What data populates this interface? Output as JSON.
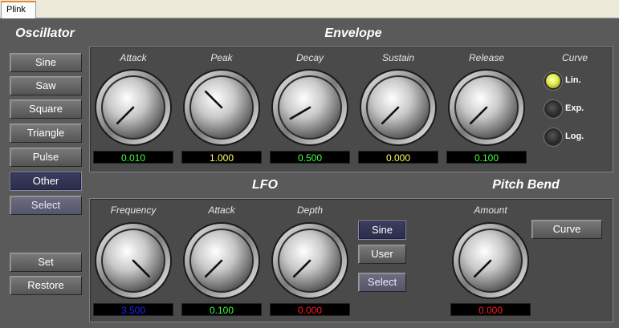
{
  "window": {
    "tab_label": "Plink"
  },
  "oscillator": {
    "title": "Oscillator",
    "buttons": [
      {
        "label": "Sine"
      },
      {
        "label": "Saw"
      },
      {
        "label": "Square"
      },
      {
        "label": "Triangle"
      },
      {
        "label": "Pulse"
      },
      {
        "label": "Other",
        "active": true
      },
      {
        "label": "Select"
      }
    ],
    "set_label": "Set",
    "restore_label": "Restore"
  },
  "envelope": {
    "title": "Envelope",
    "knobs": [
      {
        "label": "Attack",
        "value": "0.010",
        "color": "#40ff40"
      },
      {
        "label": "Peak",
        "value": "1.000",
        "color": "#ffff60"
      },
      {
        "label": "Decay",
        "value": "0.500",
        "color": "#40ff40"
      },
      {
        "label": "Sustain",
        "value": "0.000",
        "color": "#ffff60"
      },
      {
        "label": "Release",
        "value": "0.100",
        "color": "#40ff40"
      }
    ],
    "curve": {
      "title": "Curve",
      "options": [
        {
          "label": "Lin.",
          "selected": true
        },
        {
          "label": "Exp.",
          "selected": false
        },
        {
          "label": "Log.",
          "selected": false
        }
      ]
    }
  },
  "lfo": {
    "title": "LFO",
    "knobs": [
      {
        "label": "Frequency",
        "value": "3.500",
        "color": "#2222ff"
      },
      {
        "label": "Attack",
        "value": "0.100",
        "color": "#40ff40"
      },
      {
        "label": "Depth",
        "value": "0.000",
        "color": "#ff2020"
      }
    ],
    "shape_buttons": [
      {
        "label": "Sine",
        "active": true
      },
      {
        "label": "User"
      }
    ],
    "select_label": "Select"
  },
  "pitch_bend": {
    "title": "Pitch Bend",
    "knob": {
      "label": "Amount",
      "value": "0.000",
      "color": "#ff2020"
    },
    "curve_label": "Curve"
  }
}
